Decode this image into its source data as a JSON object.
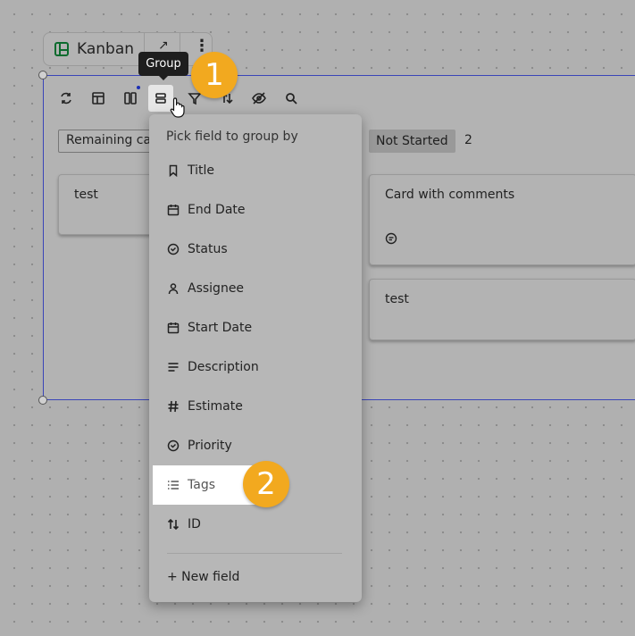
{
  "chip": {
    "title": "Kanban",
    "logo_icon": "kanban-logo-icon",
    "expand_icon": "expand-icon",
    "more_icon": "more-vertical-icon"
  },
  "toolbar": {
    "buttons": [
      "refresh-icon",
      "layout-icon",
      "columns-icon",
      "group-icon",
      "filter-icon",
      "sort-icon",
      "hide-icon",
      "search-icon"
    ],
    "tooltip": "Group"
  },
  "board": {
    "left_column": {
      "header": "Remaining cards",
      "cards": [
        "test"
      ]
    },
    "right_column": {
      "header": "Not Started",
      "count": "2",
      "cards": [
        "Card with comments",
        "test"
      ]
    }
  },
  "dropdown": {
    "heading": "Pick field to group by",
    "options": [
      {
        "label": "Title",
        "icon": "bookmark-icon"
      },
      {
        "label": "End Date",
        "icon": "calendar-icon"
      },
      {
        "label": "Status",
        "icon": "status-check-icon"
      },
      {
        "label": "Assignee",
        "icon": "person-icon"
      },
      {
        "label": "Start Date",
        "icon": "calendar-icon"
      },
      {
        "label": "Description",
        "icon": "text-lines-icon"
      },
      {
        "label": "Estimate",
        "icon": "hash-icon"
      },
      {
        "label": "Priority",
        "icon": "status-check-icon"
      },
      {
        "label": "Tags",
        "icon": "list-icon"
      },
      {
        "label": "ID",
        "icon": "sort-arrows-icon"
      }
    ],
    "new_field": "+ New field"
  },
  "callouts": {
    "one": "1",
    "two": "2"
  },
  "colors": {
    "badge": "#f2a91f",
    "selection": "#3a45b8",
    "tooltip": "#1e1e1e"
  }
}
